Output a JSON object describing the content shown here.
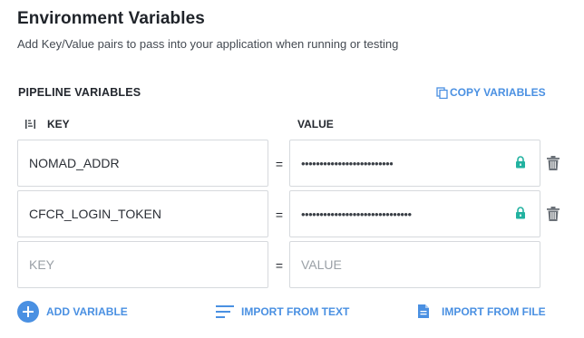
{
  "header": {
    "title": "Environment Variables",
    "subtitle": "Add Key/Value pairs to pass into your application when running or testing"
  },
  "pipeline": {
    "section_title": "PIPELINE VARIABLES",
    "copy_label": "COPY VARIABLES",
    "col_key": "KEY",
    "col_value": "VALUE",
    "equals": "=",
    "rows": [
      {
        "key": "NOMAD_ADDR",
        "value": "•••••••••••••••••••••••••"
      },
      {
        "key": "CFCR_LOGIN_TOKEN",
        "value": "••••••••••••••••••••••••••••••"
      }
    ],
    "new_row": {
      "key_placeholder": "KEY",
      "value_placeholder": "VALUE"
    }
  },
  "footer": {
    "add_label": "ADD VARIABLE",
    "import_text_label": "IMPORT FROM TEXT",
    "import_file_label": "IMPORT FROM FILE"
  },
  "colors": {
    "accent": "#4a90e2",
    "lock": "#22b2a0",
    "trash": "#6b7178"
  }
}
